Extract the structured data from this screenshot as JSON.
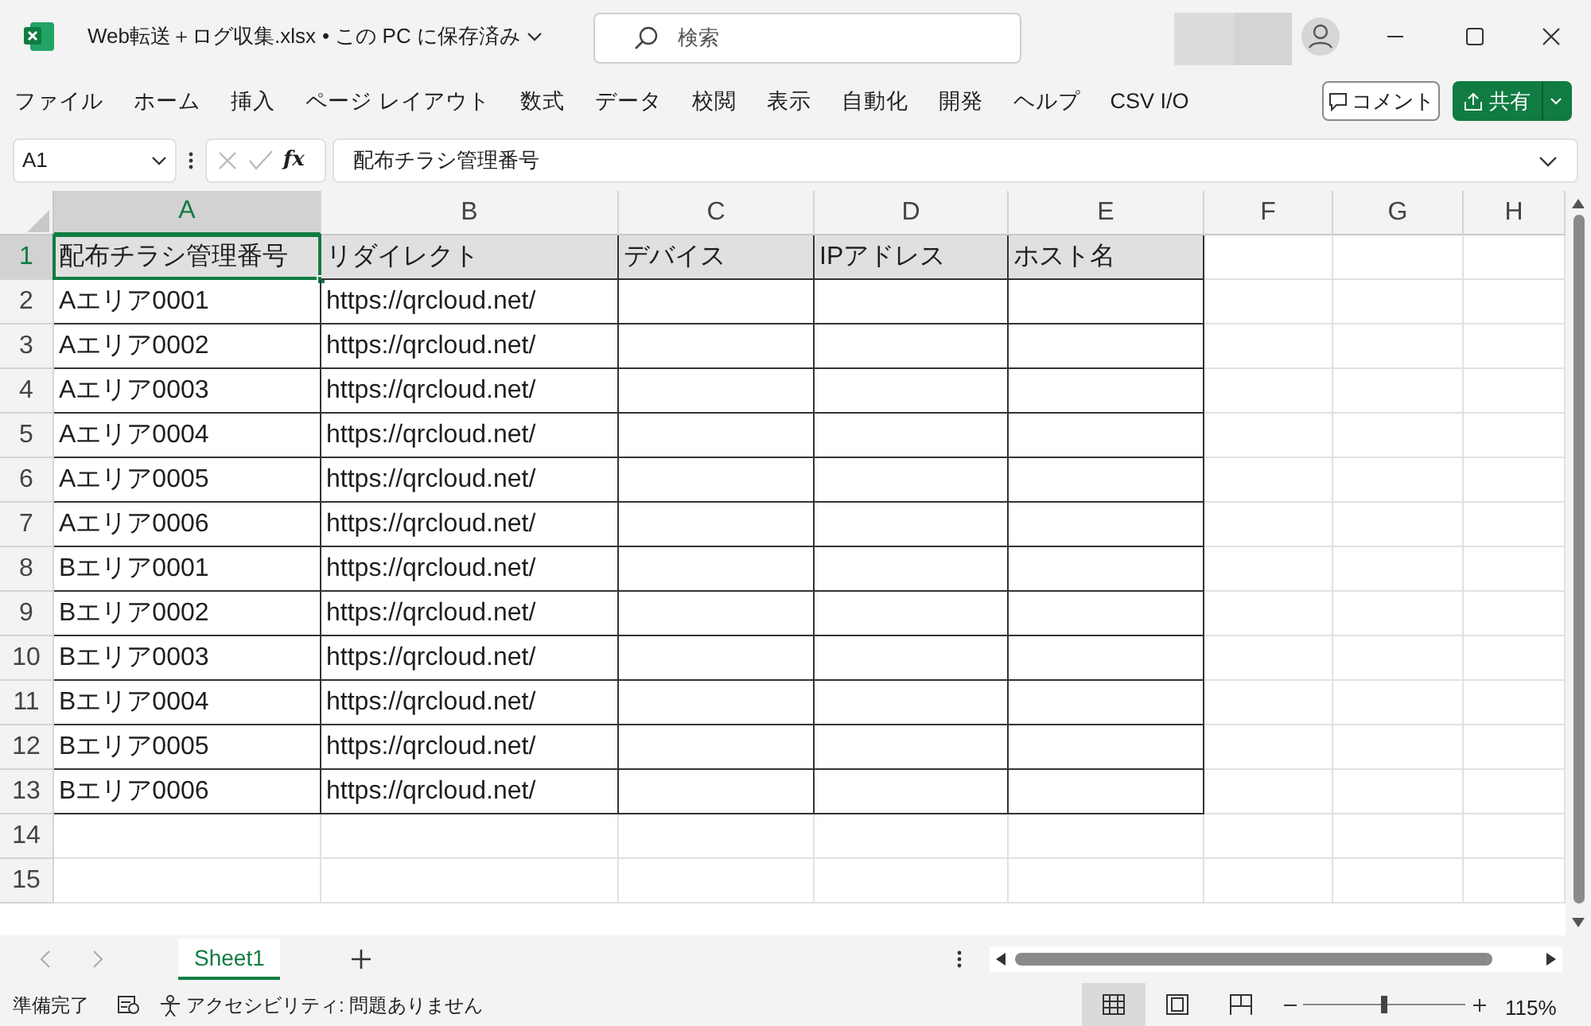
{
  "title_bar": {
    "filename": "Web転送＋ログ収集.xlsx",
    "save_status": "• この PC に保存済み",
    "search_placeholder": "検索"
  },
  "menu": [
    "ファイル",
    "ホーム",
    "挿入",
    "ページ レイアウト",
    "数式",
    "データ",
    "校閲",
    "表示",
    "自動化",
    "開発",
    "ヘルプ",
    "CSV I/O"
  ],
  "comment_button": "コメント",
  "share_button": "共有",
  "formula_bar": {
    "name_box": "A1",
    "function_label": "fx",
    "formula": "配布チラシ管理番号"
  },
  "columns": [
    {
      "label": "A",
      "selected": true
    },
    {
      "label": "B",
      "selected": false
    },
    {
      "label": "C",
      "selected": false
    },
    {
      "label": "D",
      "selected": false
    },
    {
      "label": "E",
      "selected": false
    },
    {
      "label": "F",
      "selected": false
    },
    {
      "label": "G",
      "selected": false
    },
    {
      "label": "H",
      "selected": false
    }
  ],
  "rows": [
    {
      "number": "1",
      "selected": true,
      "kind": "header",
      "cells": [
        {
          "text": "配布チラシ管理番号",
          "selected": true
        },
        {
          "text": "リダイレクト",
          "selected": false
        },
        {
          "text": "デバイス",
          "selected": false
        },
        {
          "text": "IPアドレス",
          "selected": false
        },
        {
          "text": "ホスト名",
          "selected": false
        }
      ]
    },
    {
      "number": "2",
      "selected": false,
      "kind": "data",
      "cells": [
        {
          "text": "Aエリア0001",
          "selected": false
        },
        {
          "text": "https://qrcloud.net/",
          "selected": false
        }
      ]
    },
    {
      "number": "3",
      "selected": false,
      "kind": "data",
      "cells": [
        {
          "text": "Aエリア0002",
          "selected": false
        },
        {
          "text": "https://qrcloud.net/",
          "selected": false
        }
      ]
    },
    {
      "number": "4",
      "selected": false,
      "kind": "data",
      "cells": [
        {
          "text": "Aエリア0003",
          "selected": false
        },
        {
          "text": "https://qrcloud.net/",
          "selected": false
        }
      ]
    },
    {
      "number": "5",
      "selected": false,
      "kind": "data",
      "cells": [
        {
          "text": "Aエリア0004",
          "selected": false
        },
        {
          "text": "https://qrcloud.net/",
          "selected": false
        }
      ]
    },
    {
      "number": "6",
      "selected": false,
      "kind": "data",
      "cells": [
        {
          "text": "Aエリア0005",
          "selected": false
        },
        {
          "text": "https://qrcloud.net/",
          "selected": false
        }
      ]
    },
    {
      "number": "7",
      "selected": false,
      "kind": "data",
      "cells": [
        {
          "text": "Aエリア0006",
          "selected": false
        },
        {
          "text": "https://qrcloud.net/",
          "selected": false
        }
      ]
    },
    {
      "number": "8",
      "selected": false,
      "kind": "data",
      "cells": [
        {
          "text": "Bエリア0001",
          "selected": false
        },
        {
          "text": "https://qrcloud.net/",
          "selected": false
        }
      ]
    },
    {
      "number": "9",
      "selected": false,
      "kind": "data",
      "cells": [
        {
          "text": "Bエリア0002",
          "selected": false
        },
        {
          "text": "https://qrcloud.net/",
          "selected": false
        }
      ]
    },
    {
      "number": "10",
      "selected": false,
      "kind": "data",
      "cells": [
        {
          "text": "Bエリア0003",
          "selected": false
        },
        {
          "text": "https://qrcloud.net/",
          "selected": false
        }
      ]
    },
    {
      "number": "11",
      "selected": false,
      "kind": "data",
      "cells": [
        {
          "text": "Bエリア0004",
          "selected": false
        },
        {
          "text": "https://qrcloud.net/",
          "selected": false
        }
      ]
    },
    {
      "number": "12",
      "selected": false,
      "kind": "data",
      "cells": [
        {
          "text": "Bエリア0005",
          "selected": false
        },
        {
          "text": "https://qrcloud.net/",
          "selected": false
        }
      ]
    },
    {
      "number": "13",
      "selected": false,
      "kind": "data",
      "cells": [
        {
          "text": "Bエリア0006",
          "selected": false
        },
        {
          "text": "https://qrcloud.net/",
          "selected": false
        }
      ]
    },
    {
      "number": "14",
      "selected": false,
      "kind": "empty"
    },
    {
      "number": "15",
      "selected": false,
      "kind": "empty"
    }
  ],
  "sheet_tabs": [
    {
      "label": "Sheet1",
      "selected": true
    }
  ],
  "status_bar": {
    "ready": "準備完了",
    "accessibility": "アクセシビリティ: 問題ありません",
    "views": [
      {
        "kind": "normal",
        "selected": true
      },
      {
        "kind": "page-layout",
        "selected": false
      },
      {
        "kind": "page-break",
        "selected": false
      }
    ],
    "zoom_slider": {
      "level": 0.5
    },
    "zoom": "115%"
  }
}
